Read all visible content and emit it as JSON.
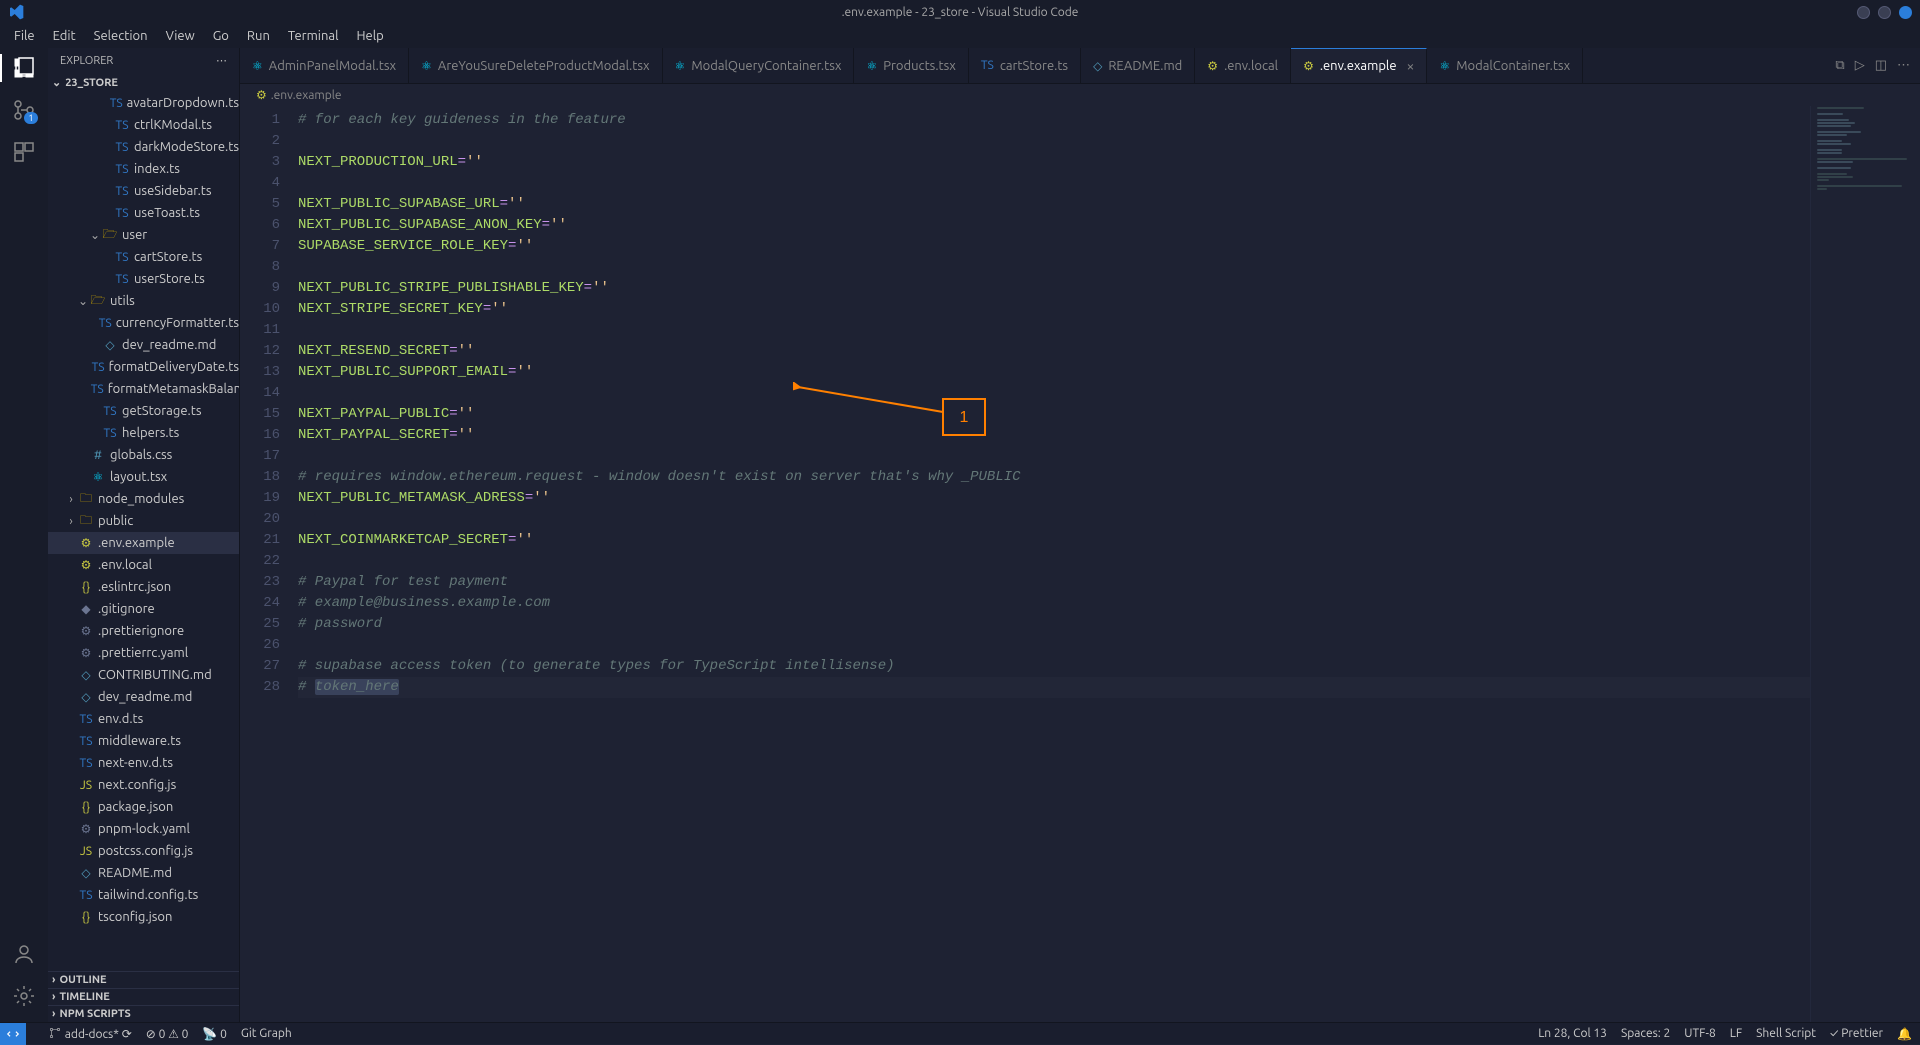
{
  "window": {
    "title": ".env.example - 23_store - Visual Studio Code"
  },
  "menu": [
    "File",
    "Edit",
    "Selection",
    "View",
    "Go",
    "Run",
    "Terminal",
    "Help"
  ],
  "scm_badge": "1",
  "sidebar": {
    "header": "EXPLORER",
    "root": "23_STORE",
    "tree": [
      {
        "depth": 4,
        "kind": "file",
        "icon": "ts",
        "label": "avatarDropdown.ts"
      },
      {
        "depth": 4,
        "kind": "file",
        "icon": "ts",
        "label": "ctrlKModal.ts"
      },
      {
        "depth": 4,
        "kind": "file",
        "icon": "ts",
        "label": "darkModeStore.ts"
      },
      {
        "depth": 4,
        "kind": "file",
        "icon": "ts",
        "label": "index.ts"
      },
      {
        "depth": 4,
        "kind": "file",
        "icon": "ts",
        "label": "useSidebar.ts"
      },
      {
        "depth": 4,
        "kind": "file",
        "icon": "ts",
        "label": "useToast.ts"
      },
      {
        "depth": 3,
        "kind": "folder-open",
        "label": "user"
      },
      {
        "depth": 4,
        "kind": "file",
        "icon": "ts",
        "label": "cartStore.ts"
      },
      {
        "depth": 4,
        "kind": "file",
        "icon": "ts",
        "label": "userStore.ts"
      },
      {
        "depth": 2,
        "kind": "folder-open",
        "label": "utils"
      },
      {
        "depth": 3,
        "kind": "file",
        "icon": "ts",
        "label": "currencyFormatter.ts"
      },
      {
        "depth": 3,
        "kind": "file",
        "icon": "md",
        "label": "dev_readme.md"
      },
      {
        "depth": 3,
        "kind": "file",
        "icon": "ts",
        "label": "formatDeliveryDate.ts"
      },
      {
        "depth": 3,
        "kind": "file",
        "icon": "ts",
        "label": "formatMetamaskBalance.ts"
      },
      {
        "depth": 3,
        "kind": "file",
        "icon": "ts",
        "label": "getStorage.ts"
      },
      {
        "depth": 3,
        "kind": "file",
        "icon": "ts",
        "label": "helpers.ts"
      },
      {
        "depth": 2,
        "kind": "file",
        "icon": "css",
        "label": "globals.css"
      },
      {
        "depth": 2,
        "kind": "file",
        "icon": "react",
        "label": "layout.tsx"
      },
      {
        "depth": 1,
        "kind": "folder-closed",
        "label": "node_modules"
      },
      {
        "depth": 1,
        "kind": "folder-closed",
        "label": "public"
      },
      {
        "depth": 1,
        "kind": "file",
        "icon": "env",
        "label": ".env.example",
        "selected": true
      },
      {
        "depth": 1,
        "kind": "file",
        "icon": "env",
        "label": ".env.local"
      },
      {
        "depth": 1,
        "kind": "file",
        "icon": "json",
        "label": ".eslintrc.json"
      },
      {
        "depth": 1,
        "kind": "file",
        "icon": "git",
        "label": ".gitignore"
      },
      {
        "depth": 1,
        "kind": "file",
        "icon": "gear",
        "label": ".prettierignore"
      },
      {
        "depth": 1,
        "kind": "file",
        "icon": "gear",
        "label": ".prettierrc.yaml"
      },
      {
        "depth": 1,
        "kind": "file",
        "icon": "md",
        "label": "CONTRIBUTING.md"
      },
      {
        "depth": 1,
        "kind": "file",
        "icon": "md",
        "label": "dev_readme.md"
      },
      {
        "depth": 1,
        "kind": "file",
        "icon": "ts",
        "label": "env.d.ts"
      },
      {
        "depth": 1,
        "kind": "file",
        "icon": "ts",
        "label": "middleware.ts"
      },
      {
        "depth": 1,
        "kind": "file",
        "icon": "ts",
        "label": "next-env.d.ts"
      },
      {
        "depth": 1,
        "kind": "file",
        "icon": "js",
        "label": "next.config.js"
      },
      {
        "depth": 1,
        "kind": "file",
        "icon": "json",
        "label": "package.json"
      },
      {
        "depth": 1,
        "kind": "file",
        "icon": "gear",
        "label": "pnpm-lock.yaml"
      },
      {
        "depth": 1,
        "kind": "file",
        "icon": "js",
        "label": "postcss.config.js"
      },
      {
        "depth": 1,
        "kind": "file",
        "icon": "md",
        "label": "README.md"
      },
      {
        "depth": 1,
        "kind": "file",
        "icon": "ts",
        "label": "tailwind.config.ts"
      },
      {
        "depth": 1,
        "kind": "file",
        "icon": "json",
        "label": "tsconfig.json"
      }
    ],
    "sections_collapsed": [
      "OUTLINE",
      "TIMELINE",
      "NPM SCRIPTS"
    ]
  },
  "tabs": [
    {
      "icon": "react",
      "label": "AdminPanelModal.tsx"
    },
    {
      "icon": "react",
      "label": "AreYouSureDeleteProductModal.tsx"
    },
    {
      "icon": "react",
      "label": "ModalQueryContainer.tsx"
    },
    {
      "icon": "react",
      "label": "Products.tsx"
    },
    {
      "icon": "ts",
      "label": "cartStore.ts"
    },
    {
      "icon": "md",
      "label": "README.md"
    },
    {
      "icon": "env",
      "label": ".env.local"
    },
    {
      "icon": "env",
      "label": ".env.example",
      "active": true
    },
    {
      "icon": "react",
      "label": "ModalContainer.tsx"
    }
  ],
  "breadcrumb": {
    "icon": "env",
    "label": ".env.example"
  },
  "code": {
    "lines": [
      {
        "n": 1,
        "t": "comment",
        "text": "# for each key guideness in the feature"
      },
      {
        "n": 2,
        "t": "blank",
        "text": ""
      },
      {
        "n": 3,
        "t": "kv",
        "key": "NEXT_PRODUCTION_URL",
        "val": "''"
      },
      {
        "n": 4,
        "t": "blank",
        "text": ""
      },
      {
        "n": 5,
        "t": "kv",
        "key": "NEXT_PUBLIC_SUPABASE_URL",
        "val": "''"
      },
      {
        "n": 6,
        "t": "kv",
        "key": "NEXT_PUBLIC_SUPABASE_ANON_KEY",
        "val": "''"
      },
      {
        "n": 7,
        "t": "kv",
        "key": "SUPABASE_SERVICE_ROLE_KEY",
        "val": "''"
      },
      {
        "n": 8,
        "t": "blank",
        "text": ""
      },
      {
        "n": 9,
        "t": "kv",
        "key": "NEXT_PUBLIC_STRIPE_PUBLISHABLE_KEY",
        "val": "''"
      },
      {
        "n": 10,
        "t": "kv",
        "key": "NEXT_STRIPE_SECRET_KEY",
        "val": "''"
      },
      {
        "n": 11,
        "t": "blank",
        "text": ""
      },
      {
        "n": 12,
        "t": "kv",
        "key": "NEXT_RESEND_SECRET",
        "val": "''"
      },
      {
        "n": 13,
        "t": "kv",
        "key": "NEXT_PUBLIC_SUPPORT_EMAIL",
        "val": "''"
      },
      {
        "n": 14,
        "t": "blank",
        "text": ""
      },
      {
        "n": 15,
        "t": "kv",
        "key": "NEXT_PAYPAL_PUBLIC",
        "val": "''"
      },
      {
        "n": 16,
        "t": "kv",
        "key": "NEXT_PAYPAL_SECRET",
        "val": "''"
      },
      {
        "n": 17,
        "t": "blank",
        "text": ""
      },
      {
        "n": 18,
        "t": "comment",
        "text": "# requires window.ethereum.request - window doesn't exist on server that's why _PUBLIC"
      },
      {
        "n": 19,
        "t": "kv",
        "key": "NEXT_PUBLIC_METAMASK_ADRESS",
        "val": "''"
      },
      {
        "n": 20,
        "t": "blank",
        "text": ""
      },
      {
        "n": 21,
        "t": "kv",
        "key": "NEXT_COINMARKETCAP_SECRET",
        "val": "''"
      },
      {
        "n": 22,
        "t": "blank",
        "text": ""
      },
      {
        "n": 23,
        "t": "comment",
        "text": "# Paypal for test payment"
      },
      {
        "n": 24,
        "t": "comment",
        "text": "# example@business.example.com"
      },
      {
        "n": 25,
        "t": "comment",
        "text": "# password"
      },
      {
        "n": 26,
        "t": "blank",
        "text": ""
      },
      {
        "n": 27,
        "t": "comment",
        "text": "# supabase access token (to generate types for TypeScript intellisense)"
      },
      {
        "n": 28,
        "t": "comment_sel",
        "prefix": "# ",
        "sel": "token_here"
      }
    ]
  },
  "annotation": {
    "label": "1"
  },
  "status": {
    "branch": "add-docs*",
    "sync": "⟳",
    "errors": "0",
    "warnings": "0",
    "port": "0",
    "gitgraph": "Git Graph",
    "lncol": "Ln 28, Col 13",
    "spaces": "Spaces: 2",
    "encoding": "UTF-8",
    "eol": "LF",
    "lang": "Shell Script",
    "prettier": "Prettier"
  }
}
